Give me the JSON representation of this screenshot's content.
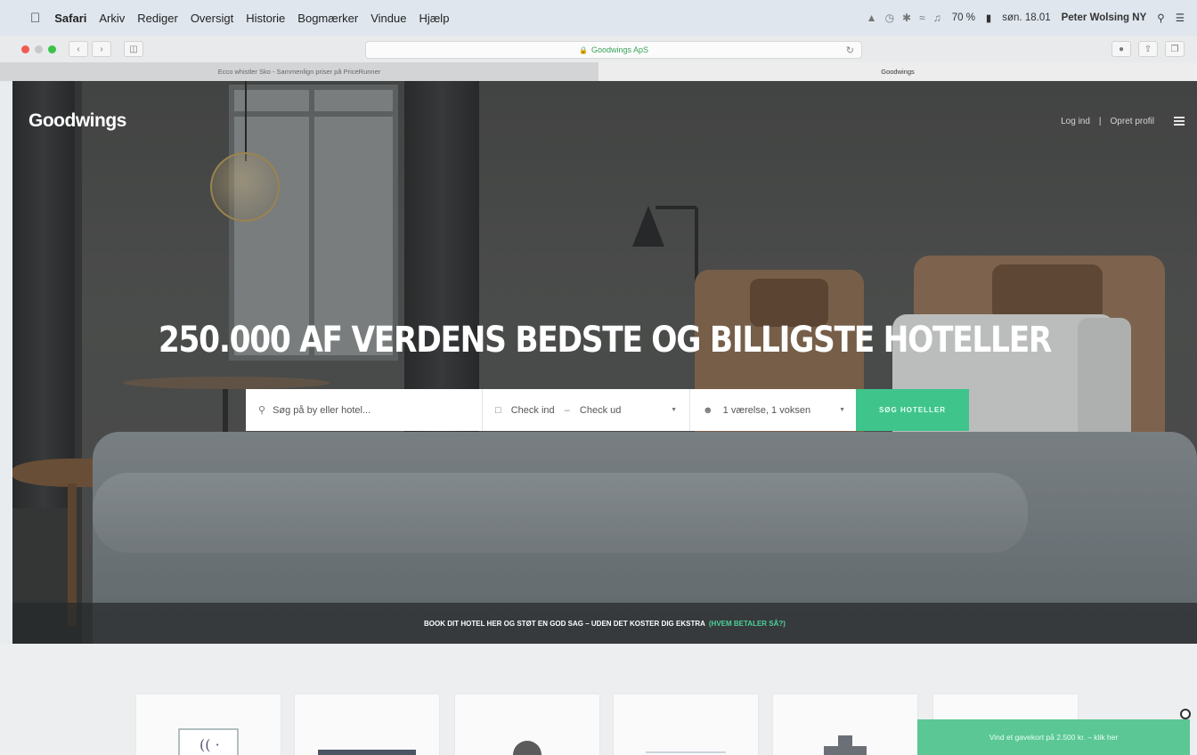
{
  "menubar": {
    "app": "Safari",
    "items": [
      "Arkiv",
      "Rediger",
      "Oversigt",
      "Historie",
      "Bogmærker",
      "Vindue",
      "Hjælp"
    ],
    "battery": "70 %",
    "datetime": "søn. 18.01",
    "user": "Peter Wolsing NY"
  },
  "browser": {
    "address": "Goodwings ApS",
    "tabs": [
      {
        "label": "Ecco whistler Sko - Sammenlign priser på PriceRunner",
        "active": false
      },
      {
        "label": "Goodwings",
        "active": true
      }
    ]
  },
  "site": {
    "logo": "Goodwings",
    "login": "Log ind",
    "divider": "|",
    "signup": "Opret profil",
    "headline": "250.000 AF VERDENS BEDSTE OG BILLIGSTE HOTELLER",
    "search": {
      "where_placeholder": "Søg på by eller hotel...",
      "checkin": "Check ind",
      "date_sep": "–",
      "checkout": "Check ud",
      "guests": "1 værelse, 1 voksen",
      "button": "SØG HOTELLER"
    },
    "strip_text": "BOOK DIT HOTEL HER OG STØT EN GOD SAG – UDEN DET KOSTER DIG EKSTRA",
    "strip_link": "(HVEM BETALER SÅ?)",
    "promo": "Vind et gavekort på 2.500 kr. – klik her"
  },
  "colors": {
    "accent": "#3fc48c",
    "promo": "#5ac794",
    "link": "#4dd39a"
  }
}
